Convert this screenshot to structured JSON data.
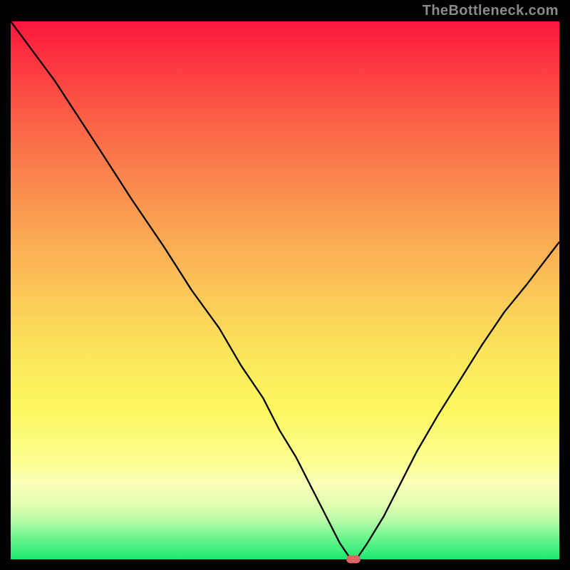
{
  "attribution_text": "TheBottleneck.com",
  "chart_data": {
    "type": "line",
    "title": "",
    "xlabel": "",
    "ylabel": "",
    "xlim": [
      0,
      100
    ],
    "ylim": [
      0,
      100
    ],
    "x": [
      0,
      8,
      16,
      22,
      28,
      33,
      38,
      42,
      46,
      49,
      52,
      55,
      57,
      59,
      60,
      62,
      63,
      65,
      68,
      71,
      74,
      78,
      82,
      86,
      90,
      94,
      100
    ],
    "bottleneck": [
      100,
      89,
      76.5,
      67,
      58,
      50,
      43,
      36,
      30,
      24,
      19,
      13,
      9,
      5,
      3,
      0,
      0,
      3,
      8,
      14,
      20,
      27,
      33.5,
      40,
      46,
      51,
      59
    ],
    "marker": {
      "x": 62.5,
      "y": 0
    }
  }
}
